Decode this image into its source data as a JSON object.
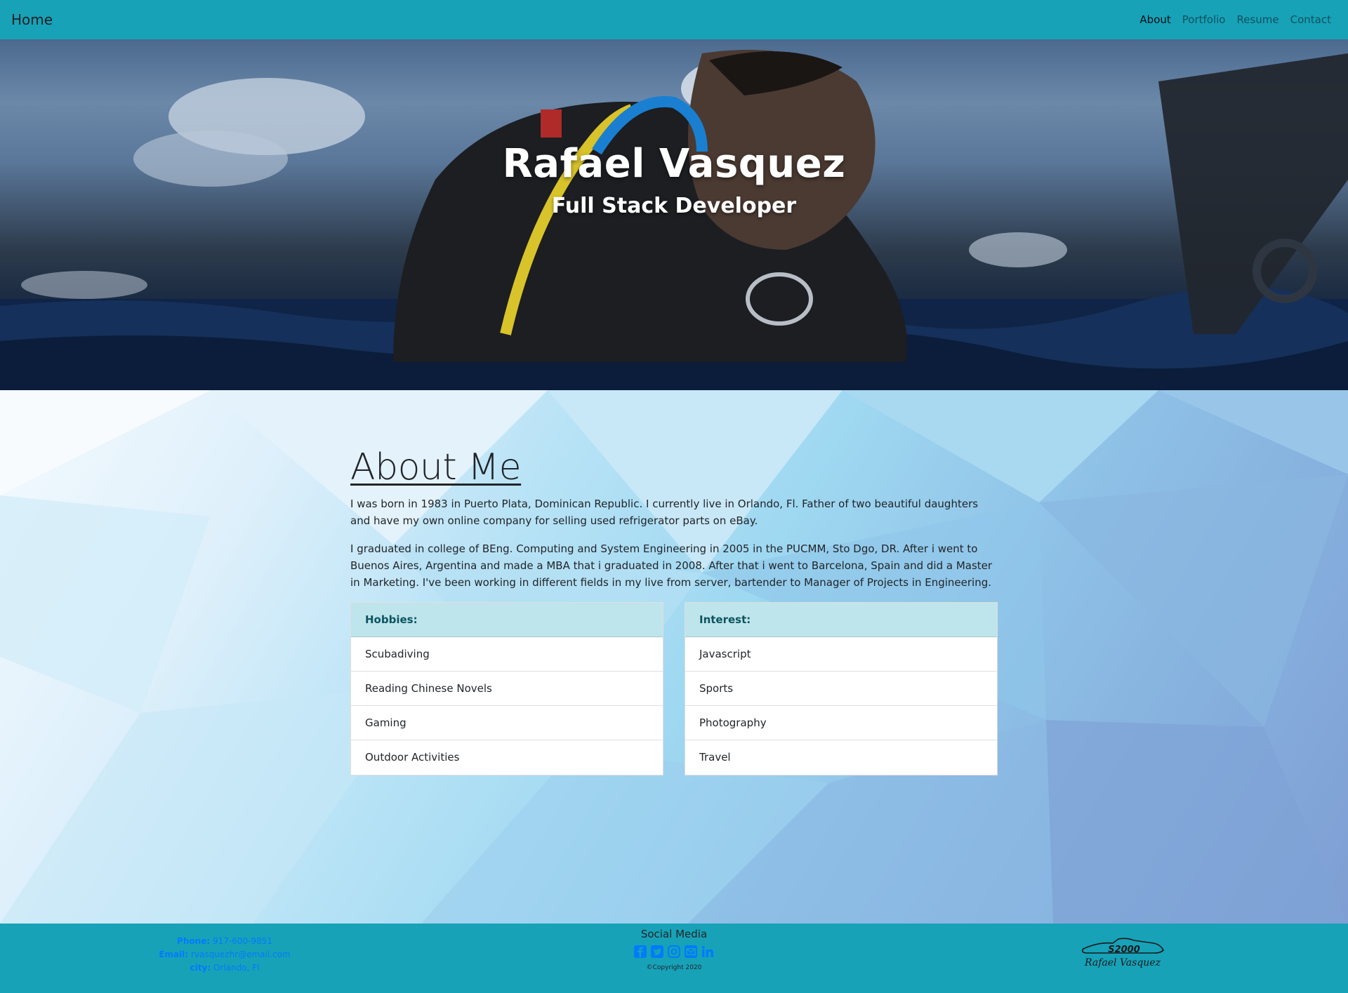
{
  "navbar": {
    "brand": "Home",
    "links": [
      "About",
      "Portfolio",
      "Resume",
      "Contact"
    ],
    "active": "About"
  },
  "hero": {
    "title": "Rafael Vasquez",
    "subtitle": "Full Stack Developer"
  },
  "about": {
    "title": "About Me",
    "paragraphs": [
      "I was born in 1983 in Puerto Plata, Dominican Republic. I currently live in Orlando, Fl. Father of two beautiful daughters and have my own online company for selling used refrigerator parts on eBay.",
      "I graduated in college of BEng. Computing and System Engineering in 2005 in the PUCMM, Sto Dgo, DR. After i went to Buenos Aires, Argentina and made a MBA that i graduated in 2008. After that i went to Barcelona, Spain and did a Master in Marketing. I've been working in different fields in my live from server, bartender to Manager of Projects in Engineering."
    ],
    "hobbies": {
      "header": "Hobbies:",
      "items": [
        "Scubadiving",
        "Reading Chinese Novels",
        "Gaming",
        "Outdoor Activities"
      ]
    },
    "interest": {
      "header": "Interest:",
      "items": [
        "Javascript",
        "Sports",
        "Photography",
        "Travel"
      ]
    }
  },
  "footer": {
    "contact": {
      "phone_label": "Phone:",
      "phone": "917-600-9851",
      "email_label": "Email:",
      "email": "rvasquezhr@email.com",
      "city_label": "city:",
      "city": "Orlando, Fl"
    },
    "social_title": "Social Media",
    "social_icons": [
      "facebook-icon",
      "twitter-icon",
      "instagram-icon",
      "email-icon",
      "linkedin-icon"
    ],
    "copyright": "©Copyright 2020",
    "logo_line1": "S2000",
    "logo_line2": "Rafael Vasquez"
  },
  "colors": {
    "navbar_bg": "#17a2b8",
    "social_icon": "#007bff",
    "list_header_bg": "#bee5eb",
    "list_header_text": "#0c5460"
  }
}
